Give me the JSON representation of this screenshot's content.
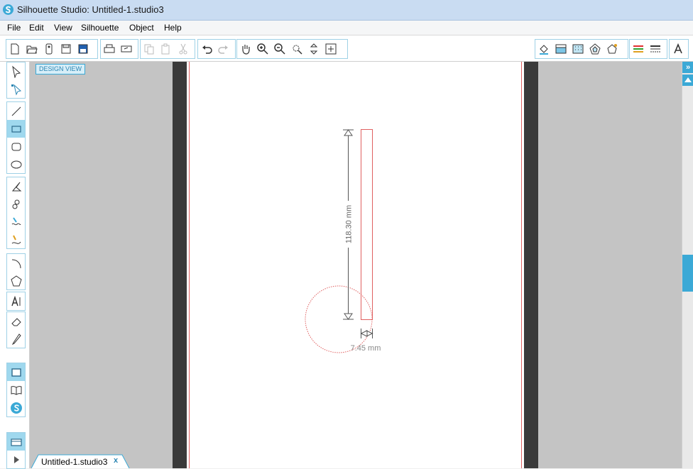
{
  "window": {
    "title": "Silhouette Studio: Untitled-1.studio3"
  },
  "menu": {
    "items": [
      "File",
      "Edit",
      "View",
      "Silhouette",
      "Object",
      "Help"
    ]
  },
  "canvas": {
    "view_label": "DESIGN VIEW",
    "height_dimension": "118.30 mm",
    "width_dimension": "7.45 mm"
  },
  "tabs": [
    {
      "label": "Untitled-1.studio3",
      "close": "x"
    }
  ],
  "panel": {
    "toggle": "»"
  },
  "colors": {
    "accent": "#3ba9d6",
    "cut_line": "#e06060",
    "mat_dark": "#3a3a3a",
    "canvas_bg": "#c4c4c4"
  },
  "icons": {
    "toolbar_file": [
      "new-document-icon",
      "open-icon",
      "open-library-icon",
      "save-icon",
      "save-to-library-icon"
    ],
    "toolbar_print": [
      "print-icon",
      "print-and-cut-icon"
    ],
    "toolbar_clipboard": [
      "copy-icon",
      "paste-icon",
      "cut-icon"
    ],
    "toolbar_history": [
      "undo-icon",
      "redo-icon"
    ],
    "toolbar_view": [
      "pan-hand-icon",
      "zoom-in-icon",
      "zoom-out-icon",
      "zoom-select-icon",
      "drag-zoom-icon",
      "fit-to-page-icon"
    ],
    "toolbar_right": [
      "fill-color-icon",
      "gradient-fill-icon",
      "pattern-fill-icon",
      "offset-icon",
      "trace-icon",
      "line-color-icon",
      "line-style-icon",
      "text-style-icon"
    ],
    "left_tools": [
      "select-tool-icon",
      "point-edit-tool-icon",
      "line-tool-icon",
      "rectangle-tool-icon",
      "rounded-rectangle-tool-icon",
      "ellipse-tool-icon",
      "polygon-tool-icon",
      "curve-tool-icon",
      "freehand-tool-icon",
      "smooth-freehand-tool-icon",
      "arc-tool-icon",
      "regular-polygon-tool-icon",
      "text-tool-icon",
      "eraser-tool-icon",
      "knife-tool-icon",
      "design-page-icon",
      "library-icon",
      "silhouette-store-icon",
      "send-to-silhouette-icon",
      "play-icon"
    ]
  }
}
